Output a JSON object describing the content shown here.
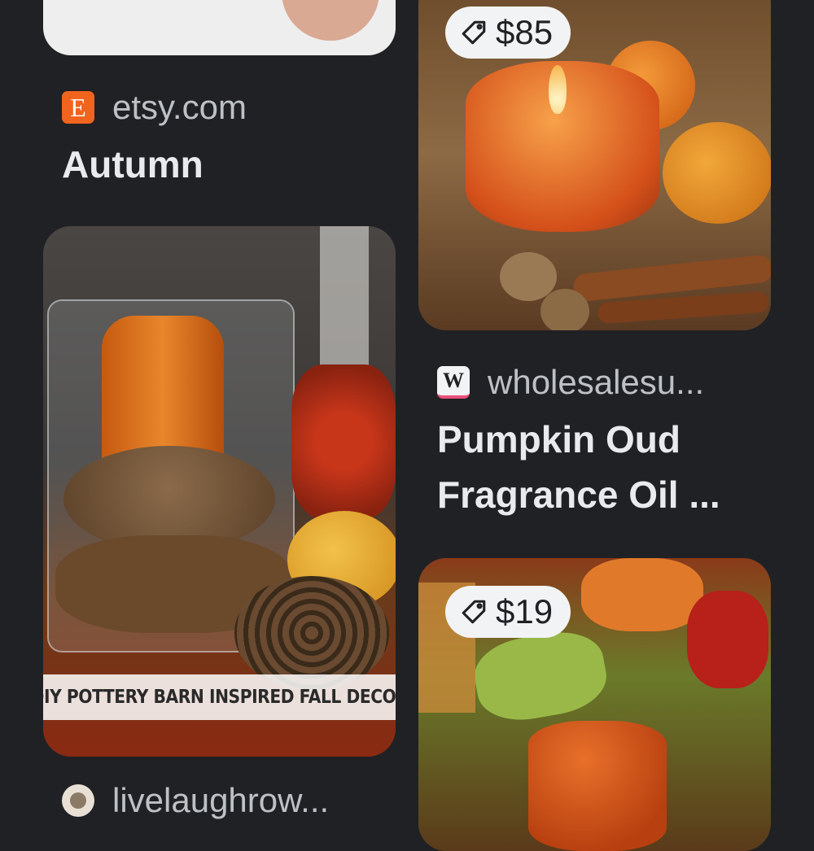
{
  "cards": [
    {
      "source": "etsy.com",
      "favicon_letter": "E",
      "favicon_color": "#f1641e",
      "title": "Autumn"
    },
    {
      "price": "$85",
      "source": "wholesalesu...",
      "favicon_letter": "W",
      "title_line1": "Pumpkin Oud",
      "title_line2": "Fragrance Oil ..."
    },
    {
      "overlay_text": "DIY POTTERY BARN INSPIRED FALL DECOR",
      "source": "livelaughrow..."
    },
    {
      "price": "$19"
    }
  ]
}
